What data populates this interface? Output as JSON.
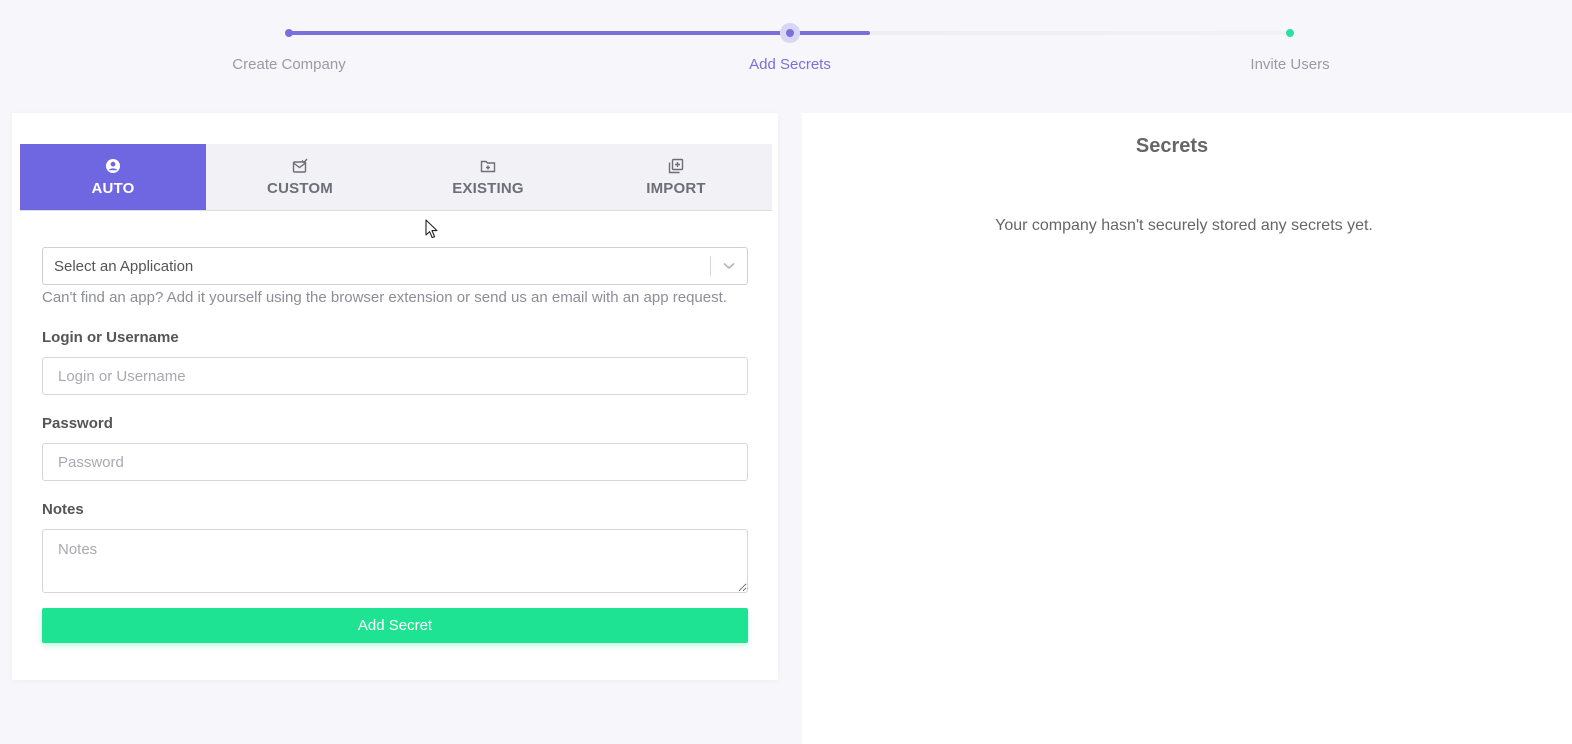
{
  "stepper": {
    "progress": 0.58,
    "steps": [
      {
        "label": "Create Company",
        "state": "done"
      },
      {
        "label": "Add Secrets",
        "state": "current"
      },
      {
        "label": "Invite Users",
        "state": "upcoming"
      }
    ]
  },
  "left": {
    "tabs": [
      {
        "label": "AUTO",
        "icon": "user-circle-icon",
        "active": true
      },
      {
        "label": "CUSTOM",
        "icon": "envelope-check-icon",
        "active": false
      },
      {
        "label": "EXISTING",
        "icon": "folder-plus-icon",
        "active": false
      },
      {
        "label": "IMPORT",
        "icon": "import-icon",
        "active": false
      }
    ],
    "app_select": {
      "value": "Select an Application"
    },
    "helper": "Can't find an app? Add it yourself using the browser extension or send us an email with an app request.",
    "login": {
      "label": "Login or Username",
      "placeholder": "Login or Username"
    },
    "password": {
      "label": "Password",
      "placeholder": "Password"
    },
    "notes": {
      "label": "Notes",
      "placeholder": "Notes"
    },
    "submit": "Add Secret"
  },
  "right": {
    "title": "Secrets",
    "empty": "Your company hasn't securely stored any secrets yet."
  },
  "colors": {
    "accent": "#6f66e2",
    "success": "#1ee392",
    "upcoming": "#2ee0a0"
  }
}
